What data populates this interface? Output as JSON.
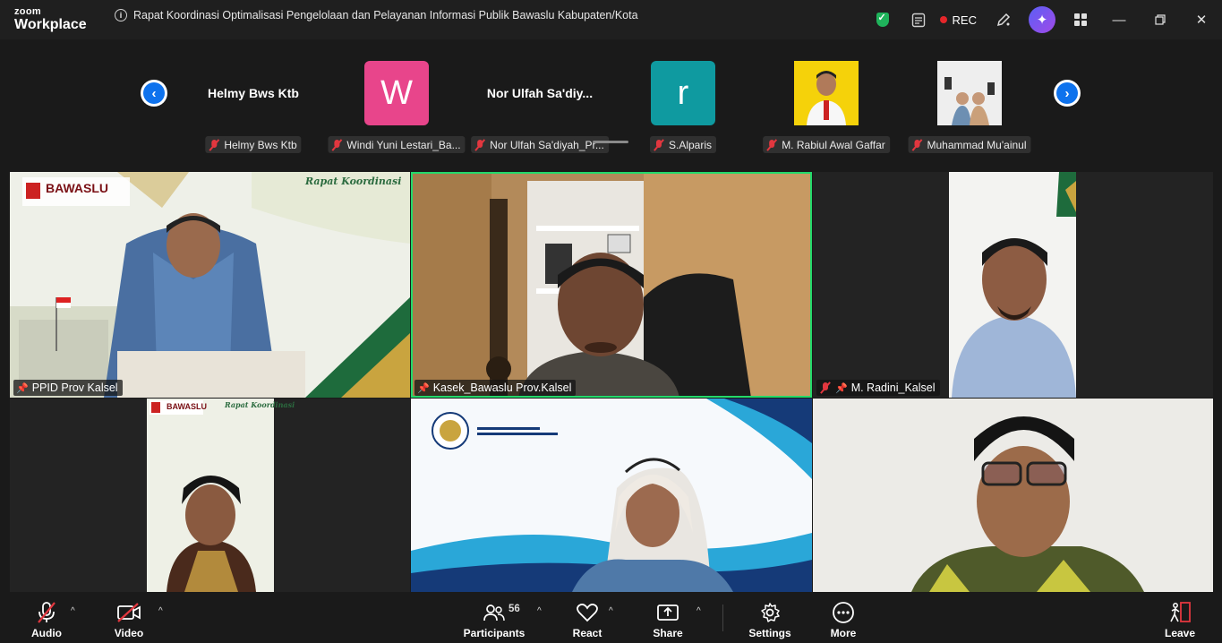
{
  "app": {
    "brand_small": "zoom",
    "brand_large": "Workplace"
  },
  "meeting": {
    "title": "Rapat Koordinasi Optimalisasi Pengelolaan dan Pelayanan Informasi Publik Bawaslu Kabupaten/Kota"
  },
  "titlebar": {
    "rec_label": "REC"
  },
  "strip": {
    "participants": [
      {
        "display": "Helmy Bws Ktb",
        "tag": "Helmy Bws Ktb",
        "type": "name",
        "muted": true
      },
      {
        "display": "W",
        "tag": "Windi Yuni Lestari_Ba...",
        "type": "avatar",
        "color": "#e8458b",
        "muted": true
      },
      {
        "display": "Nor  Ulfah  Sa'diy...",
        "tag": "Nor Ulfah Sa'diyah_Pr...",
        "type": "name",
        "muted": true
      },
      {
        "display": "r",
        "tag": "S.Alparis",
        "type": "avatar",
        "color": "#0f9aa0",
        "muted": true
      },
      {
        "display": "",
        "tag": "M. Rabiul Awal Gaffar",
        "type": "photo-yellow",
        "muted": true
      },
      {
        "display": "",
        "tag": "Muhammad Mu'ainul",
        "type": "photo-white",
        "muted": true
      }
    ]
  },
  "grid": {
    "tiles": [
      {
        "label": "PPID Prov Kalsel",
        "pinned": true,
        "muted": false,
        "banner_title": "Rapat Koordinasi",
        "banner_org": "BAWASLU"
      },
      {
        "label": "Kasek_Bawaslu Prov.Kalsel",
        "pinned": true,
        "muted": false,
        "active": true
      },
      {
        "label": "M. Radini_Kalsel",
        "pinned": true,
        "muted": true
      },
      {
        "label": "",
        "banner_title": "Rapat Koordinasi",
        "banner_org": "BAWASLU"
      },
      {
        "label": ""
      },
      {
        "label": ""
      }
    ]
  },
  "toolbar": {
    "audio": "Audio",
    "video": "Video",
    "participants": "Participants",
    "participants_count": "56",
    "react": "React",
    "share": "Share",
    "settings": "Settings",
    "more": "More",
    "leave": "Leave"
  },
  "colors": {
    "accent": "#0e72ed",
    "active_speaker": "#23d96b",
    "rec": "#e5262a",
    "mute": "#e2373f"
  }
}
